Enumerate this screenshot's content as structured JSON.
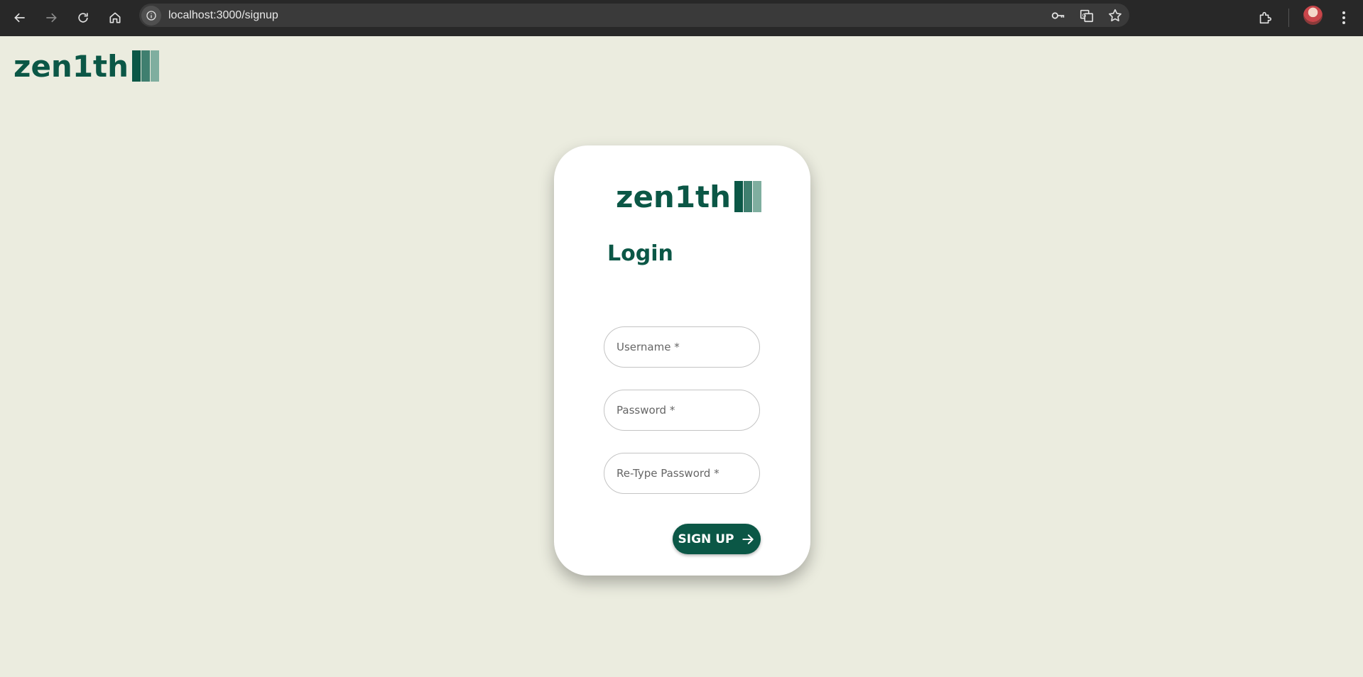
{
  "browser": {
    "url": "localhost:3000/signup"
  },
  "brand": {
    "name": "zen1th",
    "bar_colors": [
      "#0b5746",
      "#3f7f6f",
      "#7fae9f"
    ]
  },
  "form": {
    "title": "Login",
    "fields": [
      {
        "placeholder": "Username *"
      },
      {
        "placeholder": "Password *"
      },
      {
        "placeholder": "Re-Type Password *"
      }
    ],
    "submit_label": "SIGN UP"
  },
  "colors": {
    "accent": "#0b5746",
    "page_background": "#ebecdf",
    "card_background": "#ffffff"
  }
}
